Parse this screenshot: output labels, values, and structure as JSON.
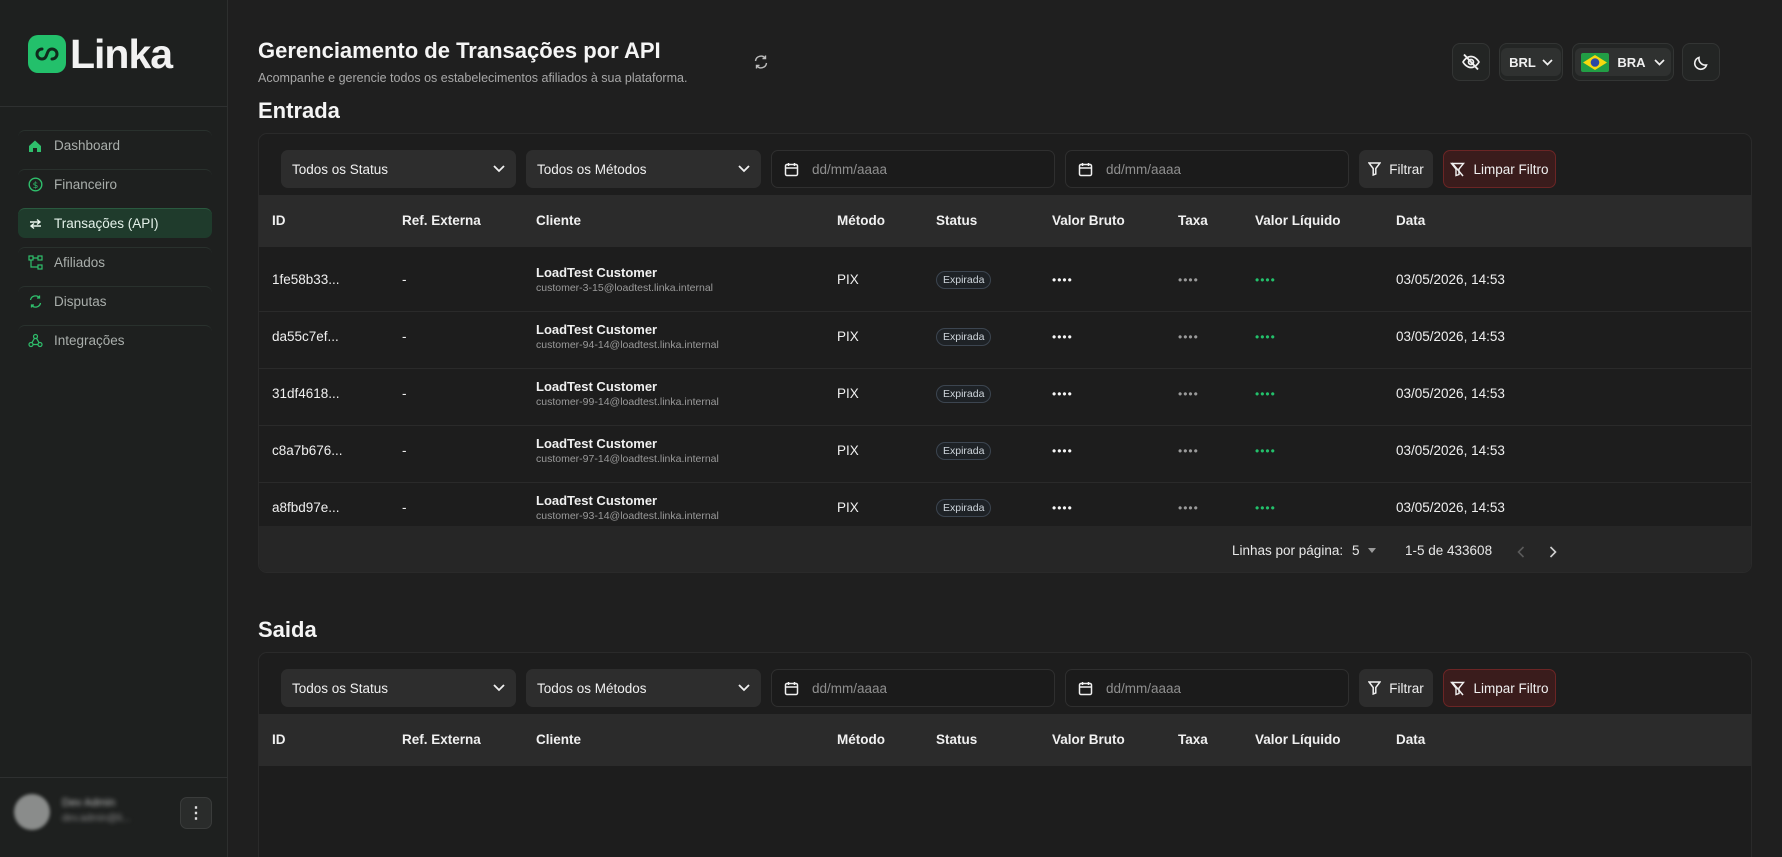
{
  "app": {
    "logo_text": "Linka"
  },
  "sidebar": {
    "items": [
      {
        "label": "Dashboard"
      },
      {
        "label": "Financeiro"
      },
      {
        "label": "Transações (API)"
      },
      {
        "label": "Afiliados"
      },
      {
        "label": "Disputas"
      },
      {
        "label": "Integrações"
      }
    ],
    "user": {
      "name": "Dev Admin",
      "email": "dev.admin@li..."
    }
  },
  "header": {
    "title": "Gerenciamento de Transações por API",
    "subtitle": "Acompanhe e gerencie todos os estabelecimentos afiliados à sua plataforma.",
    "currency": "BRL",
    "country": "BRA"
  },
  "colors": {
    "accent": "#23c06b",
    "danger_bg": "#3a1c1c",
    "danger_border": "#6b2525"
  },
  "filters": {
    "status": "Todos os Status",
    "methods": "Todos os Métodos",
    "date_placeholder": "dd/mm/aaaa",
    "filter": "Filtrar",
    "clear": "Limpar Filtro"
  },
  "columns": [
    "ID",
    "Ref. Externa",
    "Cliente",
    "Método",
    "Status",
    "Valor Bruto",
    "Taxa",
    "Valor Líquido",
    "Data"
  ],
  "entrada": {
    "title": "Entrada",
    "rows": [
      {
        "id": "1fe58b33...",
        "ref": "-",
        "customer": "LoadTest Customer",
        "email": "customer-3-15@loadtest.linka.internal",
        "method": "PIX",
        "status": "Expirada",
        "gross": "••••",
        "fee": "••••",
        "net": "••••",
        "date": "03/05/2026, 14:53"
      },
      {
        "id": "da55c7ef...",
        "ref": "-",
        "customer": "LoadTest Customer",
        "email": "customer-94-14@loadtest.linka.internal",
        "method": "PIX",
        "status": "Expirada",
        "gross": "••••",
        "fee": "••••",
        "net": "••••",
        "date": "03/05/2026, 14:53"
      },
      {
        "id": "31df4618...",
        "ref": "-",
        "customer": "LoadTest Customer",
        "email": "customer-99-14@loadtest.linka.internal",
        "method": "PIX",
        "status": "Expirada",
        "gross": "••••",
        "fee": "••••",
        "net": "••••",
        "date": "03/05/2026, 14:53"
      },
      {
        "id": "c8a7b676...",
        "ref": "-",
        "customer": "LoadTest Customer",
        "email": "customer-97-14@loadtest.linka.internal",
        "method": "PIX",
        "status": "Expirada",
        "gross": "••••",
        "fee": "••••",
        "net": "••••",
        "date": "03/05/2026, 14:53"
      },
      {
        "id": "a8fbd97e...",
        "ref": "-",
        "customer": "LoadTest Customer",
        "email": "customer-93-14@loadtest.linka.internal",
        "method": "PIX",
        "status": "Expirada",
        "gross": "••••",
        "fee": "••••",
        "net": "••••",
        "date": "03/05/2026, 14:53"
      }
    ],
    "pagination": {
      "rows_label": "Linhas por página:",
      "rows_value": "5",
      "range": "1-5 de 433608"
    }
  },
  "saida": {
    "title": "Saida"
  }
}
